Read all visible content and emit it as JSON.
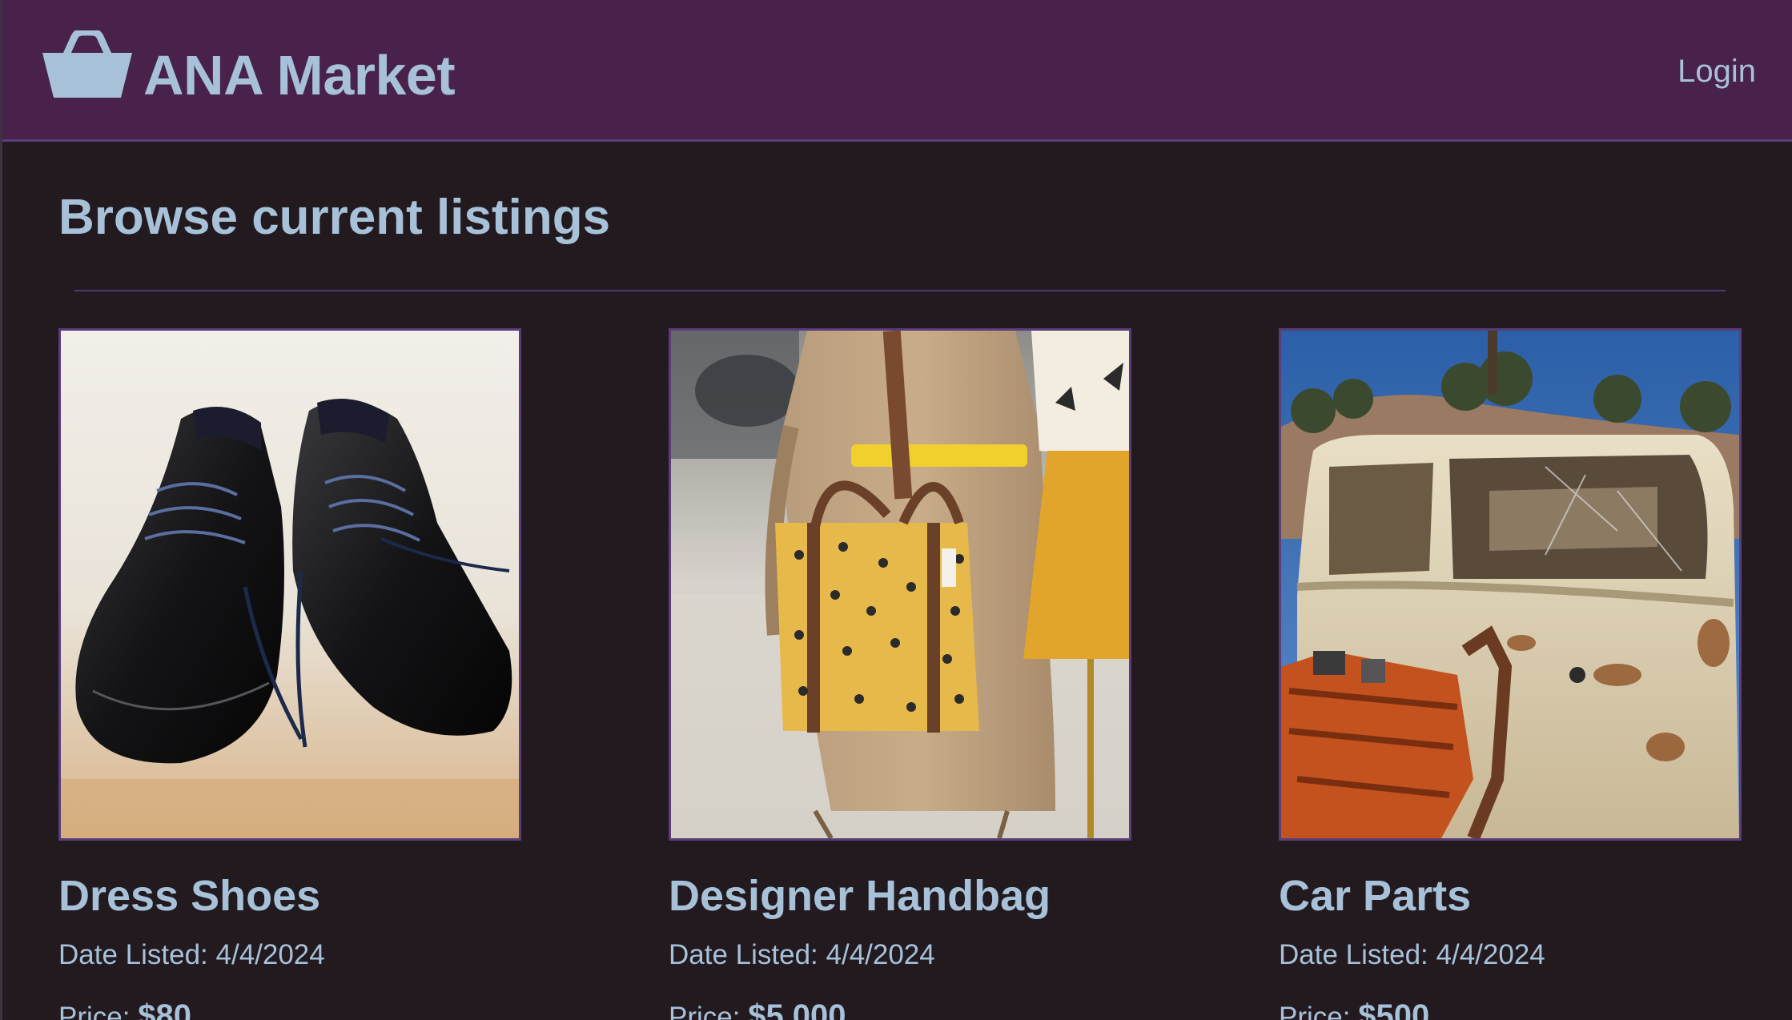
{
  "header": {
    "brand": "ANA Market",
    "login_label": "Login",
    "logo_icon": "basket-icon"
  },
  "main": {
    "title": "Browse current listings",
    "listings": [
      {
        "title": "Dress Shoes",
        "image_icon": "dress-shoes-photo",
        "date_label": "Date Listed: 4/4/2024",
        "price_label": "Price: ",
        "price_value": "$80"
      },
      {
        "title": "Designer Handbag",
        "image_icon": "designer-handbag-photo",
        "date_label": "Date Listed: 4/4/2024",
        "price_label": "Price: ",
        "price_value": "$5,000"
      },
      {
        "title": "Car Parts",
        "image_icon": "car-parts-photo",
        "date_label": "Date Listed: 4/4/2024",
        "price_label": "Price: ",
        "price_value": "$500"
      }
    ]
  },
  "colors": {
    "background": "#221a1f",
    "header_bg": "#48224a",
    "accent_text": "#a7c1d9",
    "border": "#5b3d7a"
  }
}
